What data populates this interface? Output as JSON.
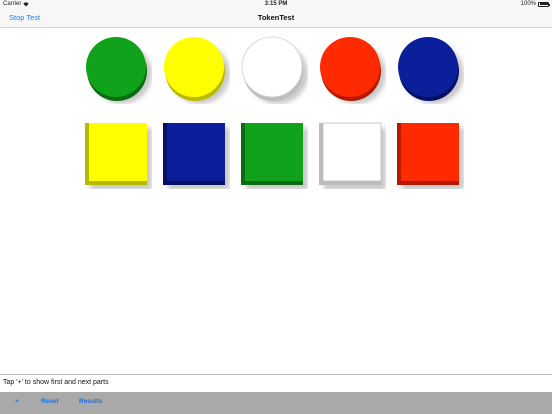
{
  "status_bar": {
    "carrier": "Carrier",
    "wifi_icon": "wifi-icon",
    "time": "3:15 PM",
    "battery_percent": "100%",
    "battery_icon": "battery-icon",
    "battery_level": 1.0
  },
  "nav_bar": {
    "left_button": "Stop Test",
    "title": "TokenTest"
  },
  "tokens": {
    "circles": [
      {
        "color_name": "green",
        "fill": "#0fa21a",
        "shade": "#0a6b12"
      },
      {
        "color_name": "yellow",
        "fill": "#ffff00",
        "shade": "#b9b900"
      },
      {
        "color_name": "white",
        "fill": "#ffffff",
        "shade": "#bdbdbd"
      },
      {
        "color_name": "red",
        "fill": "#ff2a00",
        "shade": "#b51a00"
      },
      {
        "color_name": "blue",
        "fill": "#0b1f9a",
        "shade": "#061166"
      }
    ],
    "squares": [
      {
        "color_name": "yellow",
        "fill": "#ffff00",
        "shade": "#b9b900"
      },
      {
        "color_name": "blue",
        "fill": "#0b1f9a",
        "shade": "#061166"
      },
      {
        "color_name": "green",
        "fill": "#0fa21a",
        "shade": "#0a6b12"
      },
      {
        "color_name": "white",
        "fill": "#ffffff",
        "shade": "#bdbdbd"
      },
      {
        "color_name": "red",
        "fill": "#ff2a00",
        "shade": "#b51a00"
      }
    ]
  },
  "instruction": {
    "text": "Tap '+' to show first and next parts"
  },
  "toolbar": {
    "plus_label": "+",
    "reset_label": "Reset",
    "results_label": "Results",
    "background": "#a9a9a9",
    "link_color": "#1a6fe0"
  }
}
